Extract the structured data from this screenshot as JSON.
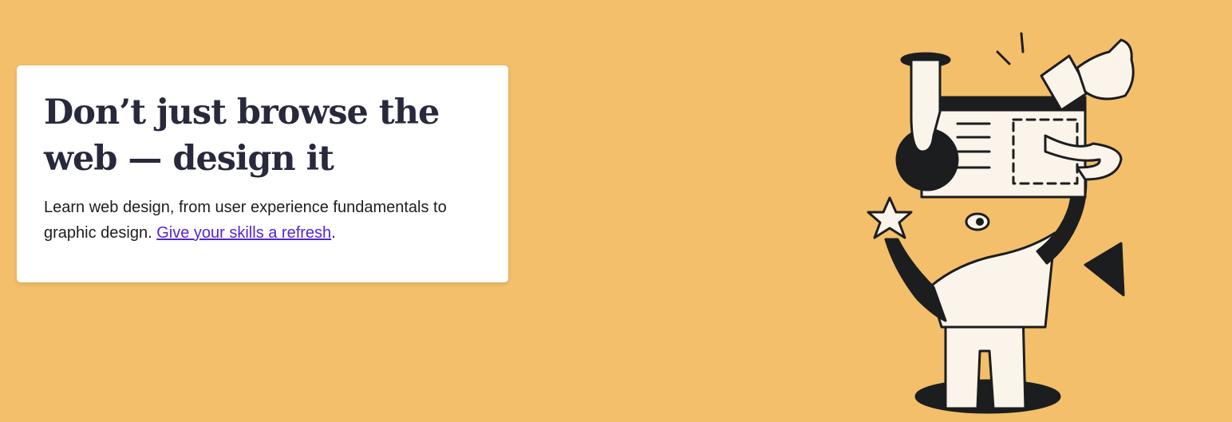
{
  "banner": {
    "background_color": "#f3bf6a",
    "headline_line1": "Don’t just browse the",
    "headline_line2": "web — design it",
    "body_lead": "Learn web design, from user experience fundamentals to graphic design.",
    "link_text": "Give your skills a refresh",
    "body_end": ".",
    "link_color": "#5624d0",
    "illustration_icon": "person-designing-webpage-illustration"
  }
}
